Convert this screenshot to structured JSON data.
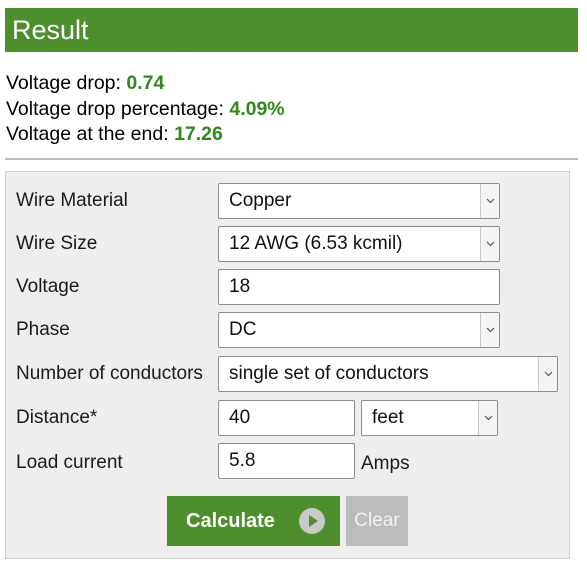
{
  "result": {
    "title": "Result",
    "lines": [
      {
        "label": "Voltage drop: ",
        "value": "0.74"
      },
      {
        "label": "Voltage drop percentage: ",
        "value": "4.09%"
      },
      {
        "label": "Voltage at the end: ",
        "value": "17.26"
      }
    ]
  },
  "form": {
    "wire_material": {
      "label": "Wire Material",
      "value": "Copper"
    },
    "wire_size": {
      "label": "Wire Size",
      "value": "12 AWG (6.53 kcmil)"
    },
    "voltage": {
      "label": "Voltage",
      "value": "18"
    },
    "phase": {
      "label": "Phase",
      "value": "DC"
    },
    "conductors": {
      "label": "Number of conductors",
      "value": "single set of conductors"
    },
    "distance": {
      "label": "Distance*",
      "value": "40",
      "unit": "feet"
    },
    "load_current": {
      "label": "Load current",
      "value": "5.8",
      "unit": "Amps"
    }
  },
  "buttons": {
    "calculate": "Calculate",
    "clear": "Clear"
  },
  "colors": {
    "accent": "#4e8f2d",
    "result_value": "#2f8a1c",
    "clear_button": "#bcbcbc",
    "form_background": "#eeeeee"
  },
  "icons": {
    "select_arrow": "chevron-down-icon",
    "calculate": "play-circle-icon"
  }
}
